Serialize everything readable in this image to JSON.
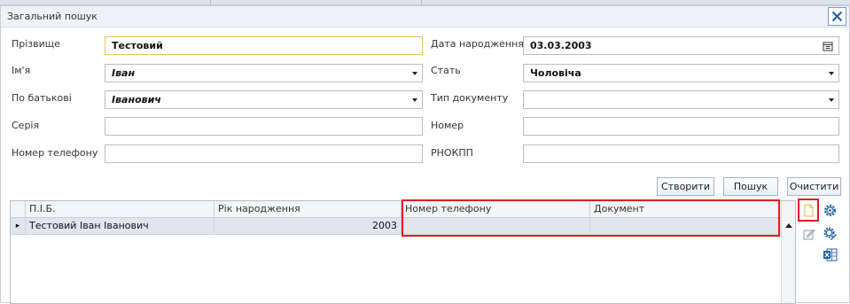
{
  "window": {
    "title": "Загальний пошук"
  },
  "form": {
    "surname": {
      "label": "Прізвище",
      "value": "Тестовий"
    },
    "first_name": {
      "label": "Ім'я",
      "value": "Іван"
    },
    "patronymic": {
      "label": "По батькові",
      "value": "Іванович"
    },
    "series": {
      "label": "Серія",
      "value": ""
    },
    "phone": {
      "label": "Номер телефону",
      "value": ""
    },
    "birth_date": {
      "label": "Дата народження",
      "value": "03.03.2003"
    },
    "gender": {
      "label": "Стать",
      "value": "Чоловіча"
    },
    "doc_type": {
      "label": "Тип документу",
      "value": ""
    },
    "number": {
      "label": "Номер",
      "value": ""
    },
    "rnokpp": {
      "label": "РНОКПП",
      "value": ""
    }
  },
  "buttons": {
    "create": "Створити",
    "search": "Пошук",
    "clear": "Очистити"
  },
  "grid": {
    "columns": [
      "П.І.Б.",
      "Рік народження",
      "Номер телефону",
      "Документ"
    ],
    "rows": [
      {
        "name": "Тестовий Іван Іванович",
        "year": "2003",
        "phone": "",
        "document": ""
      }
    ],
    "row_marker": "▸"
  },
  "icons": {
    "close": "close-icon",
    "calendar": "calendar-icon",
    "new_document": "new-document-icon",
    "edit": "edit-icon",
    "settings": "gear-icon",
    "settings_edit": "gear-edit-icon",
    "excel_export": "excel-icon"
  },
  "colors": {
    "highlight": "#e21c1c",
    "accent": "#2b6cb0",
    "active_border": "#f2c05b",
    "selected_row": "#e1e5ec"
  }
}
